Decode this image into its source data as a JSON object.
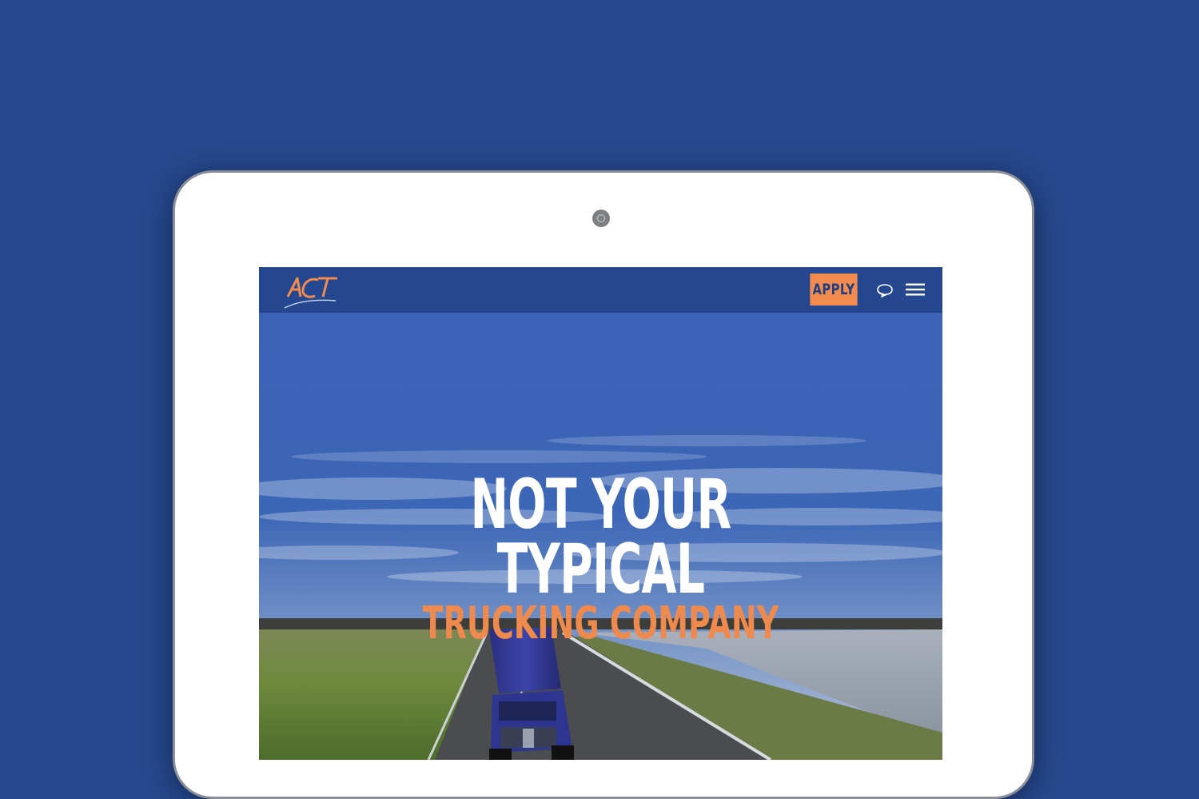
{
  "header": {
    "logo_text": "ACT",
    "apply_label": "APPLY",
    "chat_icon": "speech-bubble-icon",
    "menu_icon": "hamburger-menu-icon"
  },
  "hero": {
    "line1": "NOT YOUR",
    "line2": "TYPICAL",
    "line3": "TRUCKING COMPANY"
  },
  "colors": {
    "background": "#26498f",
    "navbar": "#24478f",
    "accent_orange": "#f18b50",
    "headline_white": "#ffffff",
    "headline_orange": "#ee8a4e"
  }
}
